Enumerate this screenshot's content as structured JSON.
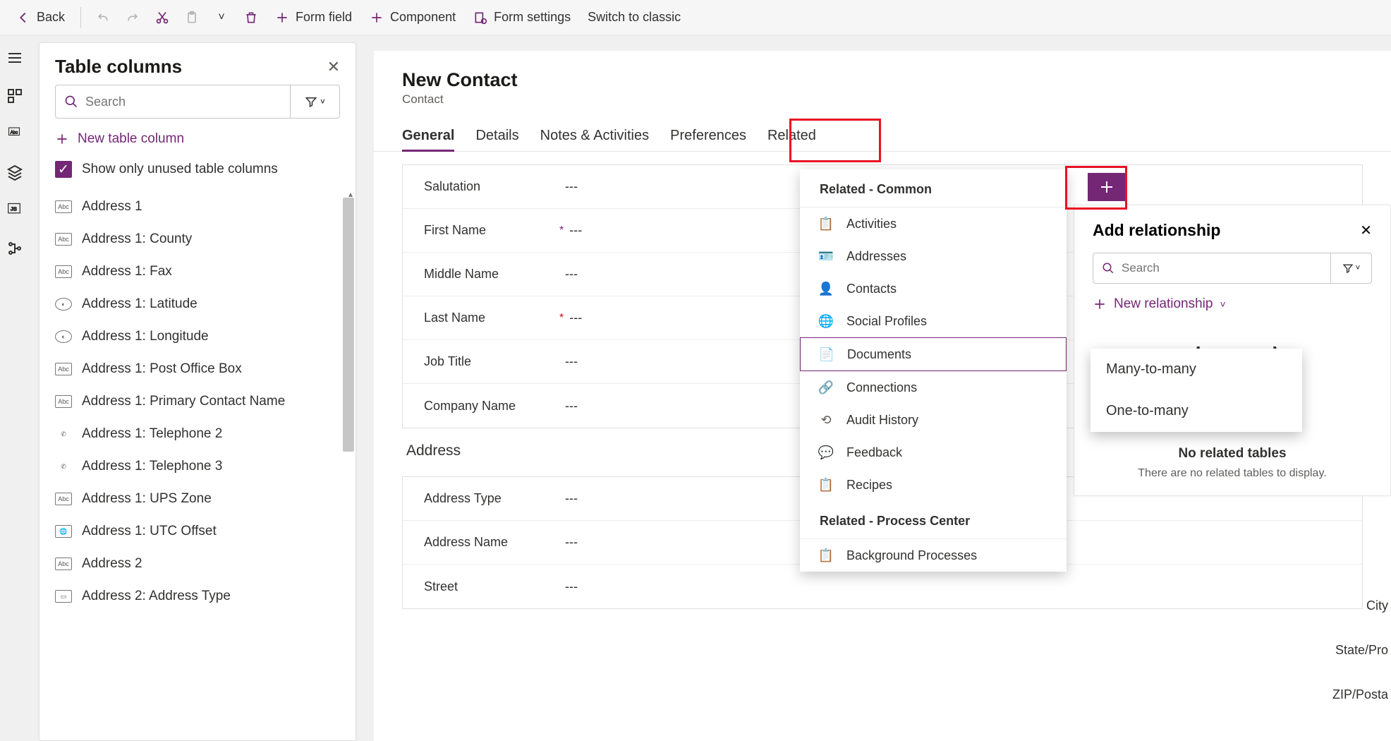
{
  "toolbar": {
    "back": "Back",
    "form_field": "Form field",
    "component": "Component",
    "form_settings": "Form settings",
    "switch": "Switch to classic"
  },
  "table_panel": {
    "title": "Table columns",
    "search_placeholder": "Search",
    "new_col": "New table column",
    "show_unused": "Show only unused table columns",
    "items": [
      {
        "icon": "abc",
        "label": "Address 1"
      },
      {
        "icon": "abc",
        "label": "Address 1: County"
      },
      {
        "icon": "abc",
        "label": "Address 1: Fax"
      },
      {
        "icon": "globe",
        "label": "Address 1: Latitude"
      },
      {
        "icon": "globe",
        "label": "Address 1: Longitude"
      },
      {
        "icon": "abc",
        "label": "Address 1: Post Office Box"
      },
      {
        "icon": "abc",
        "label": "Address 1: Primary Contact Name"
      },
      {
        "icon": "phone",
        "label": "Address 1: Telephone 2"
      },
      {
        "icon": "phone",
        "label": "Address 1: Telephone 3"
      },
      {
        "icon": "abc",
        "label": "Address 1: UPS Zone"
      },
      {
        "icon": "tz",
        "label": "Address 1: UTC Offset"
      },
      {
        "icon": "abc",
        "label": "Address 2"
      },
      {
        "icon": "rect",
        "label": "Address 2: Address Type"
      }
    ]
  },
  "form": {
    "title": "New Contact",
    "subtitle": "Contact",
    "tabs": [
      "General",
      "Details",
      "Notes & Activities",
      "Preferences",
      "Related"
    ],
    "fields": [
      {
        "label": "Salutation",
        "req": "",
        "val": "---"
      },
      {
        "label": "First Name",
        "req": "rec",
        "val": "---"
      },
      {
        "label": "Middle Name",
        "req": "",
        "val": "---"
      },
      {
        "label": "Last Name",
        "req": "req",
        "val": "---"
      },
      {
        "label": "Job Title",
        "req": "",
        "val": "---"
      },
      {
        "label": "Company Name",
        "req": "",
        "val": "---"
      }
    ],
    "section2_title": "Address",
    "fields2": [
      {
        "label": "Address Type",
        "val": "---"
      },
      {
        "label": "Address Name",
        "val": "---"
      },
      {
        "label": "Street",
        "val": "---"
      }
    ],
    "right_labels": [
      "City",
      "State/Pro",
      "ZIP/Posta"
    ]
  },
  "related_menu": {
    "group1": "Related - Common",
    "items1": [
      "Activities",
      "Addresses",
      "Contacts",
      "Social Profiles",
      "Documents",
      "Connections",
      "Audit History",
      "Feedback",
      "Recipes"
    ],
    "selected": "Documents",
    "group2": "Related - Process Center",
    "items2": [
      "Background Processes"
    ]
  },
  "rel_panel": {
    "title": "Add relationship",
    "search_placeholder": "Search",
    "new_rel": "New relationship",
    "empty_title": "No related tables",
    "empty_sub": "There are no related tables to display."
  },
  "rel_types": [
    "Many-to-many",
    "One-to-many"
  ]
}
